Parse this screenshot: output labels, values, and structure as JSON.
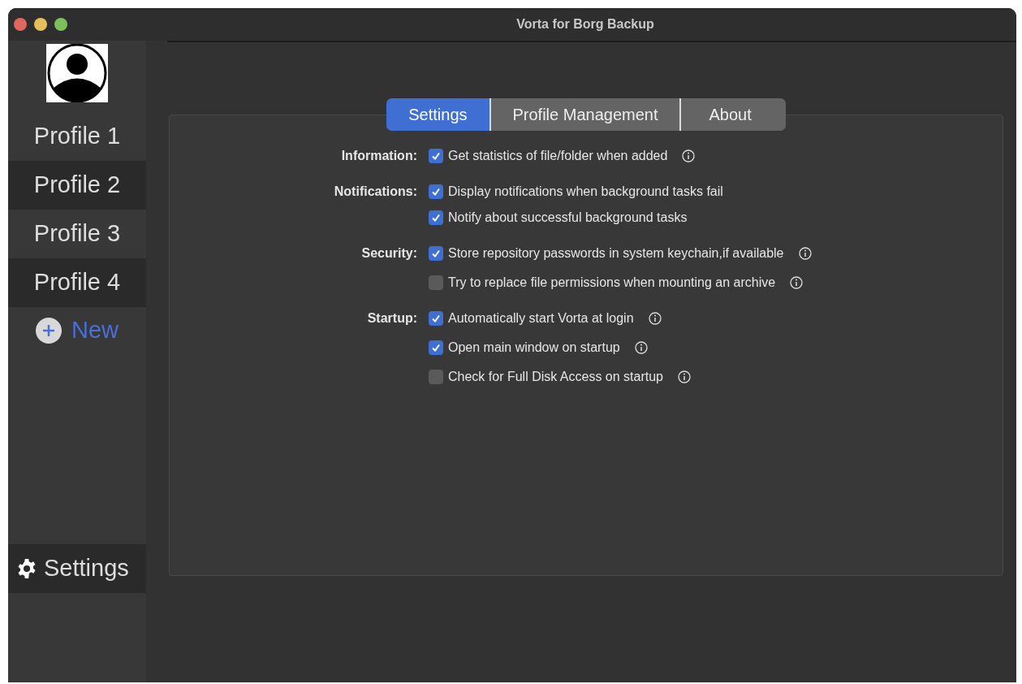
{
  "window": {
    "title": "Vorta for Borg Backup"
  },
  "sidebar": {
    "items": [
      {
        "label": "Profile 1"
      },
      {
        "label": "Profile 2"
      },
      {
        "label": "Profile 3"
      },
      {
        "label": "Profile 4"
      }
    ],
    "new_button": {
      "label": "New"
    },
    "settings_button": {
      "label": "Settings"
    }
  },
  "tabs": [
    {
      "label": "Settings",
      "selected": true
    },
    {
      "label": "Profile Management",
      "selected": false
    },
    {
      "label": "About",
      "selected": false
    }
  ],
  "sections": [
    {
      "label": "Information:",
      "options": [
        {
          "text": "Get statistics of file/folder when added",
          "checked": true,
          "info": true
        }
      ]
    },
    {
      "label": "Notifications:",
      "options": [
        {
          "text": "Display notifications when background tasks fail",
          "checked": true,
          "info": false
        },
        {
          "text": "Notify about successful background tasks",
          "checked": true,
          "info": false
        }
      ]
    },
    {
      "label": "Security:",
      "options": [
        {
          "text": "Store repository passwords in system keychain,if available",
          "checked": true,
          "info": true
        },
        {
          "text": "Try to replace file permissions when mounting an archive",
          "checked": false,
          "info": true
        }
      ]
    },
    {
      "label": "Startup:",
      "options": [
        {
          "text": "Automatically start Vorta at login",
          "checked": true,
          "info": true
        },
        {
          "text": "Open main window on startup",
          "checked": true,
          "info": true
        },
        {
          "text": "Check for Full Disk Access on startup",
          "checked": false,
          "info": true
        }
      ]
    }
  ]
}
